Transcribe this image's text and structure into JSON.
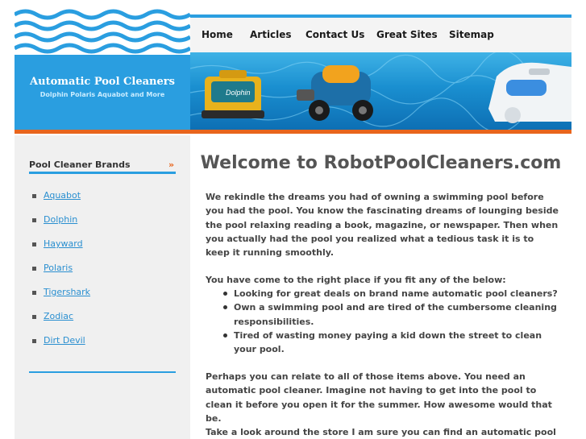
{
  "logo": {
    "title": "Automatic Pool Cleaners",
    "subtitle": "Dolphin Polaris Aquabot and More"
  },
  "nav": {
    "items": [
      "Home",
      "Articles",
      "Contact Us",
      "Great Sites",
      "Sitemap"
    ]
  },
  "sidebar": {
    "heading": "Pool Cleaner Brands",
    "links": [
      "Aquabot",
      "Dolphin",
      "Hayward",
      "Polaris",
      "Tigershark",
      "Zodiac",
      "Dirt Devil"
    ]
  },
  "main": {
    "title": "Welcome to RobotPoolCleaners.com",
    "intro": "We rekindle the dreams you had of owning a swimming pool before you had the pool. You know the fascinating dreams of lounging beside the pool relaxing reading a book, magazine, or newspaper. Then when you actually had the pool you realized what a tedious task it is to keep it running smoothly.",
    "lead_in": "You have come to the right place if you fit any of the below:",
    "bullets": [
      "Looking for great deals on brand name automatic pool cleaners?",
      "Own a swimming pool and are tired of the cumbersome cleaning responsibilities.",
      "Tired of wasting money paying a kid down the street to clean your pool."
    ],
    "relate": "Perhaps you can relate to all of those items above. You need an automatic pool cleaner. Imagine not having to get into the pool to clean it before you open it for the summer. How awesome would that be.",
    "closing": "Take a look around the store I am sure you can find an automatic pool"
  },
  "colors": {
    "accent_blue": "#2a9ee0",
    "accent_orange": "#e8651d",
    "link": "#2a8fd0"
  },
  "icons": {
    "sidebar_heading": "double-chevron-down-icon"
  }
}
